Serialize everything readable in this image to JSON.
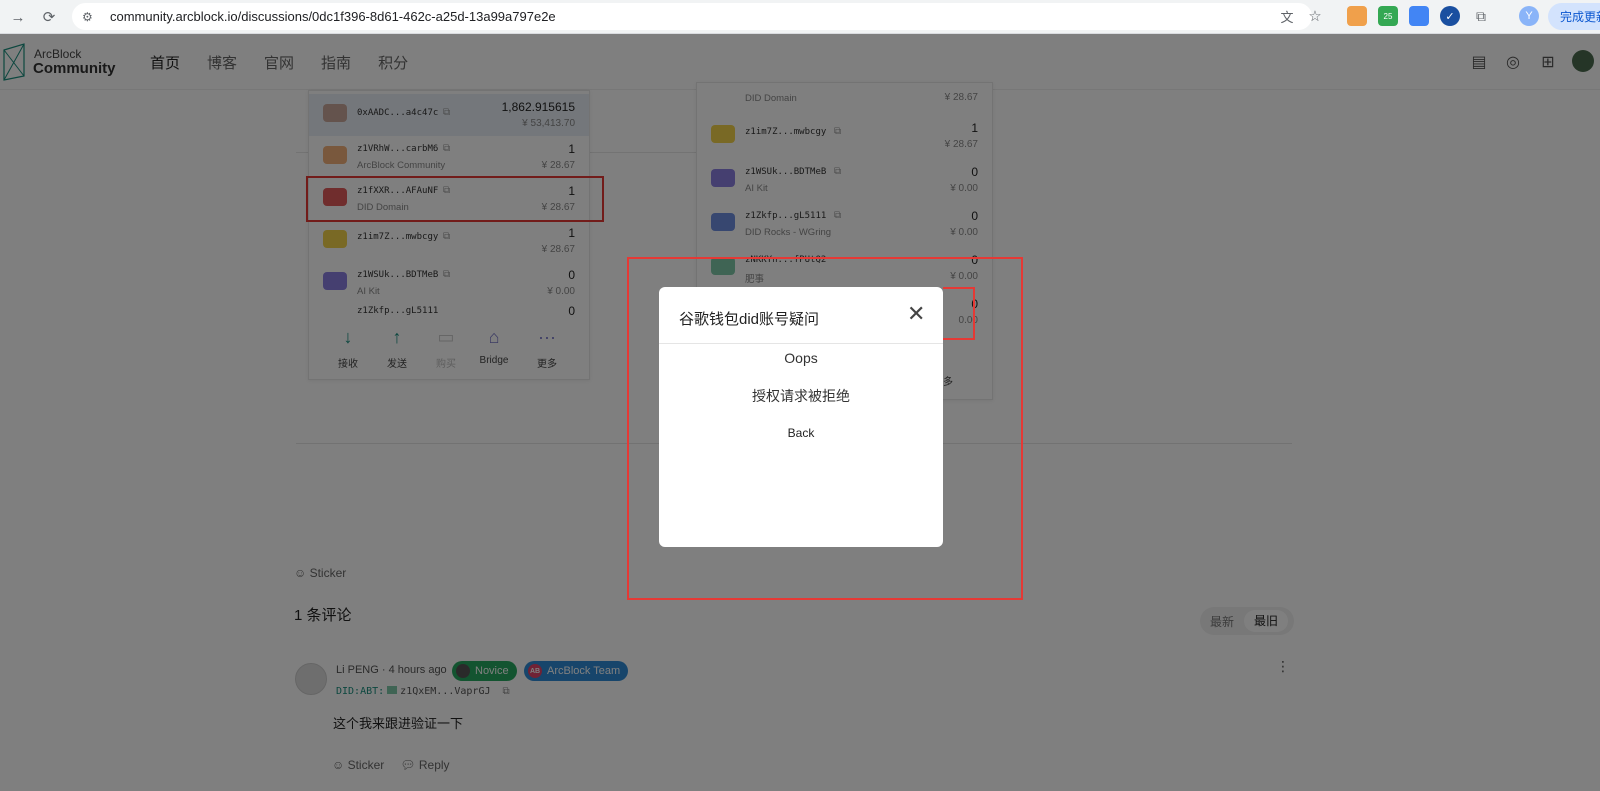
{
  "browser": {
    "url": "community.arcblock.io/discussions/0dc1f396-8d61-462c-a25d-13a99a797e2e",
    "extension_badge": "25",
    "profile_initial": "Y",
    "update_button": "完成更新"
  },
  "site": {
    "logo_line1": "ArcBlock",
    "logo_line2": "Community",
    "nav": [
      "首页",
      "博客",
      "官网",
      "指南",
      "积分"
    ]
  },
  "wallet_left": {
    "rows": [
      {
        "addr": "0xAADC...a4c47c",
        "sub": "",
        "amount": "1,862.915615",
        "value": "¥ 53,413.70"
      },
      {
        "addr": "z1VRhW...carbM6",
        "sub": "ArcBlock Community",
        "amount": "1",
        "value": "¥ 28.67"
      },
      {
        "addr": "z1fXXR...AFAuNF",
        "sub": "DID Domain",
        "amount": "1",
        "value": "¥ 28.67"
      },
      {
        "addr": "z1im7Z...mwbcgy",
        "sub": "",
        "amount": "1",
        "value": "¥ 28.67"
      },
      {
        "addr": "z1WSUk...BDTMeB",
        "sub": "AI Kit",
        "amount": "0",
        "value": "¥ 0.00"
      },
      {
        "addr": "z1Zkfp...gL5111",
        "sub": "",
        "amount": "0",
        "value": ""
      }
    ],
    "actions": [
      "接收",
      "发送",
      "购买",
      "Bridge",
      "更多"
    ]
  },
  "wallet_right": {
    "rows": [
      {
        "addr": "",
        "sub": "DID Domain",
        "amount": "",
        "value": "¥ 28.67"
      },
      {
        "addr": "z1im7Z...mwbcgy",
        "sub": "",
        "amount": "1",
        "value": "¥ 28.67"
      },
      {
        "addr": "z1WSUk...BDTMeB",
        "sub": "AI Kit",
        "amount": "0",
        "value": "¥ 0.00"
      },
      {
        "addr": "z1Zkfp...gL5111",
        "sub": "DID Rocks - WGring",
        "amount": "0",
        "value": "¥ 0.00"
      },
      {
        "addr": "zNKKYn...fPUtQ2",
        "sub": "肥事",
        "amount": "0",
        "value": "¥ 0.00"
      },
      {
        "addr": "",
        "sub": "",
        "amount": "0",
        "value": "0.00"
      }
    ],
    "more_label": "更多"
  },
  "post": {
    "sticker_label": "Sticker",
    "comment_count": "1 条评论",
    "sort_newest": "最新",
    "sort_oldest": "最旧"
  },
  "comment": {
    "author": "Li PENG",
    "time": "· 4 hours ago",
    "badge_novice": "Novice",
    "badge_team": "ArcBlock Team",
    "badge_team_icon": "AB",
    "did_prefix": "DID:ABT:",
    "did_value": "z1QxEM...VaprGJ",
    "body": "这个我来跟进验证一下",
    "sticker_label": "Sticker",
    "reply_label": "Reply"
  },
  "modal": {
    "title": "谷歌钱包did账号疑问",
    "oops": "Oops",
    "message": "授权请求被拒绝",
    "back_label": "Back"
  },
  "colors": {
    "accent": "#1a8f7f",
    "highlight_red": "#e53935",
    "novice_badge": "#27a960",
    "team_badge": "#2f8bd6"
  }
}
